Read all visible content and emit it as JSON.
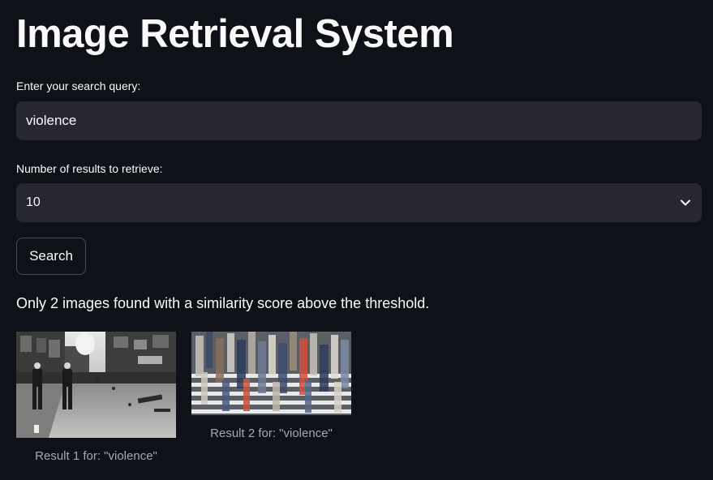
{
  "page": {
    "title": "Image Retrieval System"
  },
  "query": {
    "label": "Enter your search query:",
    "value": "violence"
  },
  "results_count": {
    "label": "Number of results to retrieve:",
    "selected": "10"
  },
  "search": {
    "button_label": "Search"
  },
  "status": {
    "message": "Only 2 images found with a similarity score above the threshold."
  },
  "results": [
    {
      "caption": "Result 1 for: \"violence\""
    },
    {
      "caption": "Result 2 for: \"violence\""
    }
  ],
  "colors": {
    "background": "#0e1117",
    "input_background": "#262730",
    "text": "#fafafa",
    "caption": "#a3a8b4"
  }
}
